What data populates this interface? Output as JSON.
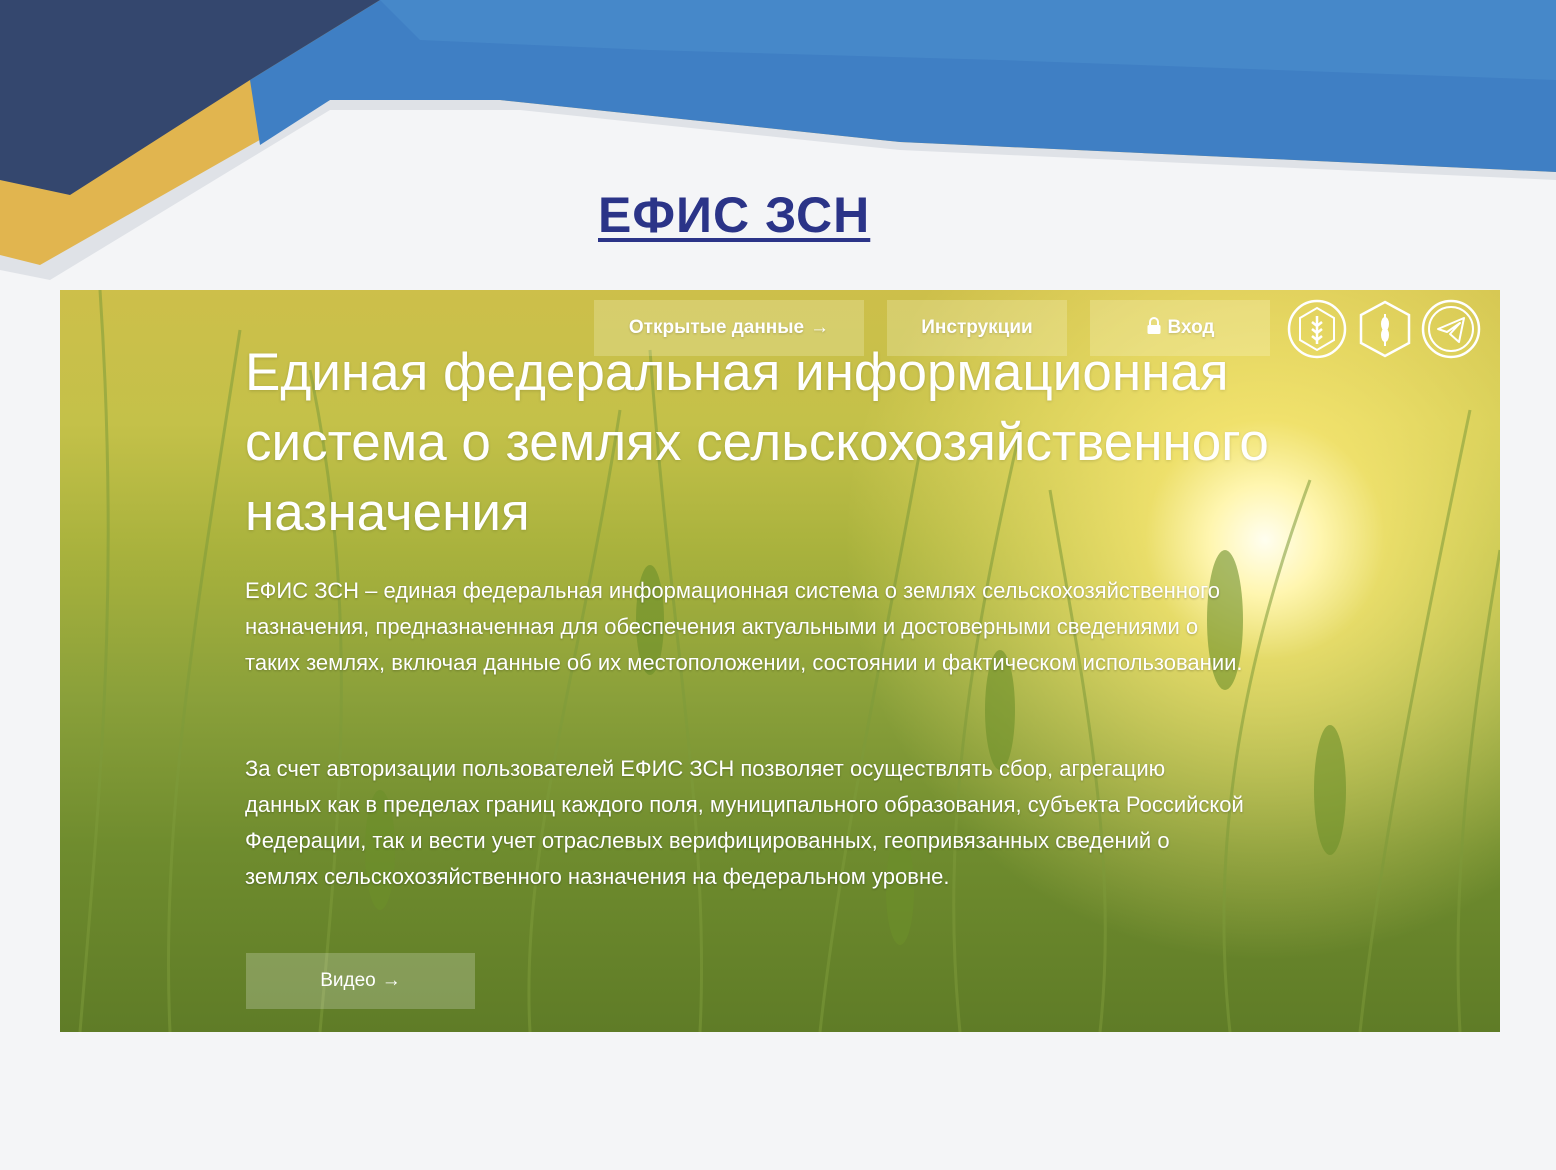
{
  "slide": {
    "title": "ЕФИС ЗСН",
    "colors": {
      "navy": "#34476e",
      "blue": "#3f7fc4",
      "gold": "#e1b54f",
      "title": "#2b3488"
    }
  },
  "hero": {
    "nav": {
      "open_data": {
        "label": "Открытые данные",
        "icon": "arrow-right-icon"
      },
      "instructions": {
        "label": "Инструкции"
      },
      "login": {
        "label": "Вход",
        "icon": "lock-icon"
      }
    },
    "icons": [
      "wheat-hexagon-icon",
      "wheat-hexagon-icon",
      "telegram-icon"
    ],
    "title": "Единая федеральная информационная система о землях сельскохозяйственного назначения",
    "paragraph_1": "ЕФИС ЗСН – единая федеральная информационная система о землях сельскохозяйственного назначения, предназначенная для обеспечения актуальными и достоверными сведениями о таких землях, включая данные об их местоположении, состоянии и фактическом использовании.",
    "paragraph_2": "За счет авторизации пользователей ЕФИС ЗСН позволяет осуществлять сбор, агрегацию данных как в пределах границ каждого поля, муниципального образования, субъекта Российской Федерации, так и вести учет отраслевых верифицированных, геопривязанных сведений о землях сельскохозяйственного назначения на федеральном уровне.",
    "video_button": {
      "label": "Видео",
      "icon": "arrow-right-icon"
    }
  }
}
